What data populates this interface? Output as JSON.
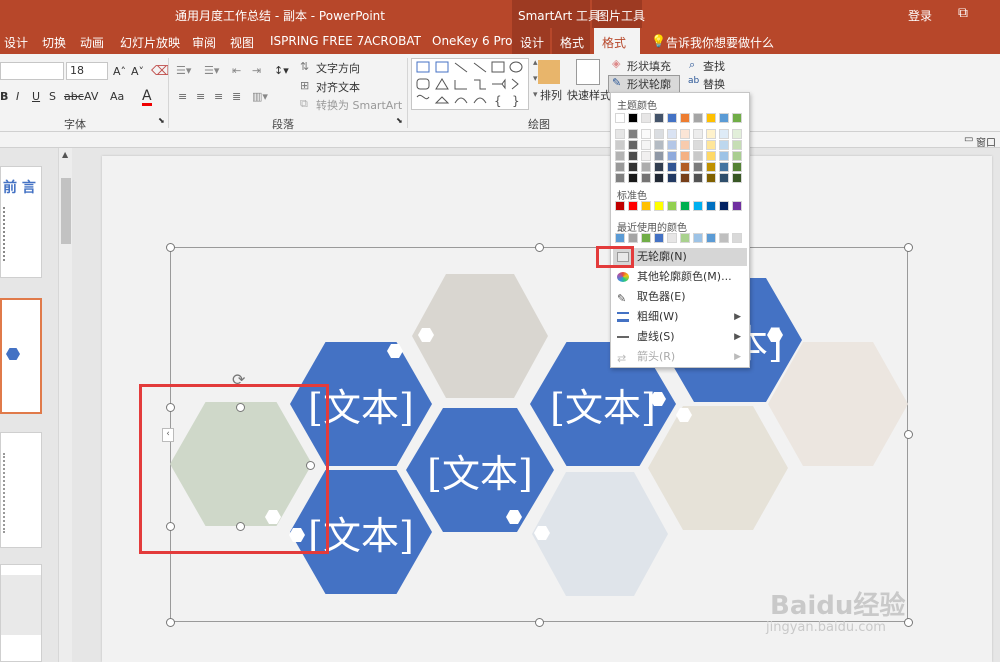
{
  "titlebar": {
    "title": "通用月度工作总结 - 副本 - PowerPoint",
    "ctx_smartart": "SmartArt 工具",
    "ctx_picture": "图片工具",
    "login": "登录",
    "window_btn": "⧉"
  },
  "tabs": [
    "设计",
    "切换",
    "动画",
    "幻灯片放映",
    "审阅",
    "视图",
    "ISPRING FREE 7",
    "ACROBAT",
    "OneKey 6 Pro",
    "设计",
    "格式",
    "格式"
  ],
  "tell_me": "告诉我你想要做什么",
  "ribbon": {
    "font_size": "18",
    "font_group": "字体",
    "paragraph_group": "段落",
    "drawing_group": "绘图",
    "text_direction": "文字方向",
    "align_text": "对齐文本",
    "convert_smartart": "转换为 SmartArt",
    "arrange": "排列",
    "quick_styles": "快速样式",
    "shape_fill": "形状填充",
    "shape_outline": "形状轮廓",
    "find": "查找",
    "replace": "替换",
    "bold": "B",
    "italic": "I",
    "underline": "U",
    "strike": "S",
    "font_color_a": "A",
    "grow_font": "A˄",
    "shrink_font": "A˅",
    "aa": "Aa",
    "av": "AV"
  },
  "belowbar": {
    "right": "窗口合"
  },
  "thumbs": {
    "slide1_title": "前 言"
  },
  "slide": {
    "texts": [
      "[文本]",
      "[文本]",
      "[文本]",
      "[文本]",
      "[文本]"
    ]
  },
  "dropdown": {
    "theme_colors": "主题颜色",
    "standard_colors": "标准色",
    "recent_colors": "最近使用的颜色",
    "no_outline": "无轮廓(N)",
    "more_colors": "其他轮廓颜色(M)...",
    "eyedropper": "取色器(E)",
    "weight": "粗细(W)",
    "dashes": "虚线(S)",
    "arrows": "箭头(R)",
    "theme_top": [
      "#ffffff",
      "#000000",
      "#e7e6e6",
      "#44546a",
      "#4472c4",
      "#ed7d31",
      "#a5a5a5",
      "#ffc000",
      "#5b9bd5",
      "#70ad47"
    ],
    "standard": [
      "#c00000",
      "#ff0000",
      "#ffc000",
      "#ffff00",
      "#92d050",
      "#00b050",
      "#00b0f0",
      "#0070c0",
      "#002060",
      "#7030a0"
    ],
    "recent": [
      "#5b9bd5",
      "#a5a5a5",
      "#70ad47",
      "#4472c4",
      "#e7e6e6",
      "#a9d18e",
      "#9dc3e6",
      "#5b9bd5",
      "#bfbfbf",
      "#d9d9d9"
    ]
  },
  "watermark": {
    "brand": "Baidu经验",
    "url": "jingyan.baidu.com"
  }
}
